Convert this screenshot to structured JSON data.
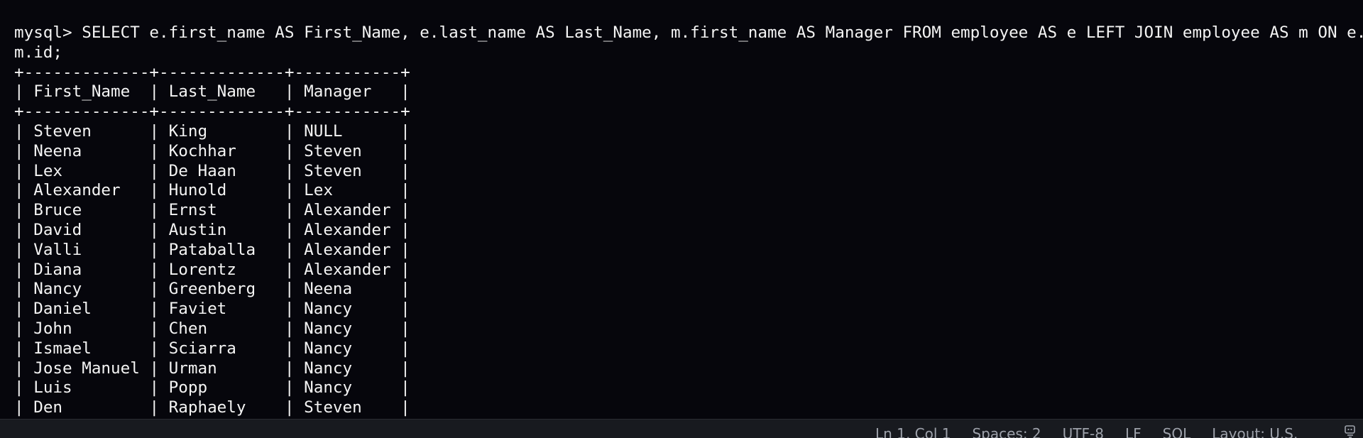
{
  "terminal": {
    "prompt": "mysql> ",
    "query_line1": "SELECT e.first_name AS First_Name, e.last_name AS Last_Name, m.first_name AS Manager FROM employee AS e LEFT JOIN employee AS m ON e.manager_id =",
    "query_line2": "m.id;",
    "border": "+-------------+-------------+-----------+",
    "columns": [
      "First_Name",
      "Last_Name",
      "Manager"
    ],
    "rows": [
      [
        "Steven",
        "King",
        "NULL"
      ],
      [
        "Neena",
        "Kochhar",
        "Steven"
      ],
      [
        "Lex",
        "De Haan",
        "Steven"
      ],
      [
        "Alexander",
        "Hunold",
        "Lex"
      ],
      [
        "Bruce",
        "Ernst",
        "Alexander"
      ],
      [
        "David",
        "Austin",
        "Alexander"
      ],
      [
        "Valli",
        "Pataballa",
        "Alexander"
      ],
      [
        "Diana",
        "Lorentz",
        "Alexander"
      ],
      [
        "Nancy",
        "Greenberg",
        "Neena"
      ],
      [
        "Daniel",
        "Faviet",
        "Nancy"
      ],
      [
        "John",
        "Chen",
        "Nancy"
      ],
      [
        "Ismael",
        "Sciarra",
        "Nancy"
      ],
      [
        "Jose Manuel",
        "Urman",
        "Nancy"
      ],
      [
        "Luis",
        "Popp",
        "Nancy"
      ],
      [
        "Den",
        "Raphaely",
        "Steven"
      ]
    ]
  },
  "status_bar": {
    "position": "Ln 1, Col 1",
    "spaces": "Spaces: 2",
    "encoding": "UTF-8",
    "eol": "LF",
    "language": "SQL",
    "layout": "Layout: U.S.",
    "feedback_icon": "feedback-icon"
  }
}
